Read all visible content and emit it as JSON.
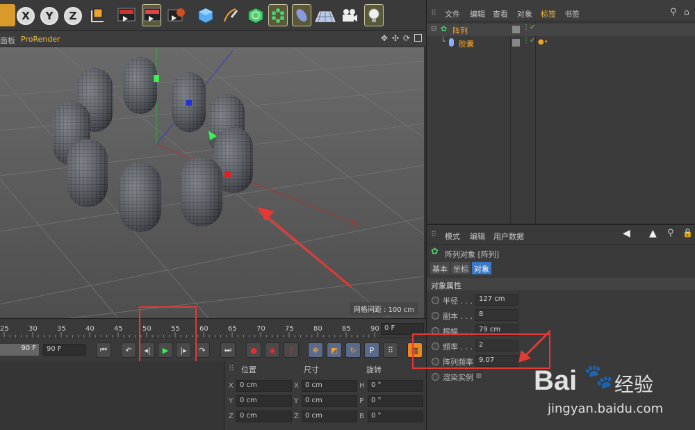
{
  "viewport_menu": {
    "panel_stub": "面板",
    "renderer": "ProRender",
    "grid_spacing": "网格间距 : 100 cm"
  },
  "timeline": {
    "ticks": [
      "25",
      "30",
      "35",
      "40",
      "45",
      "50",
      "55",
      "60",
      "65",
      "70",
      "75",
      "80",
      "85",
      "90"
    ],
    "current_frame": "0 F"
  },
  "transport": {
    "start_frame": "90 F",
    "end_frame": "90 F"
  },
  "coords": {
    "headers": [
      "位置",
      "尺寸",
      "旋转"
    ],
    "rows": [
      {
        "a": "X",
        "pos": "0 cm",
        "b": "X",
        "size": "0 cm",
        "c": "H",
        "rot": "0 °"
      },
      {
        "a": "Y",
        "pos": "0 cm",
        "b": "Y",
        "size": "0 cm",
        "c": "P",
        "rot": "0 °"
      },
      {
        "a": "Z",
        "pos": "0 cm",
        "b": "Z",
        "size": "0 cm",
        "c": "B",
        "rot": "0 °"
      }
    ]
  },
  "object_manager": {
    "menu": [
      "文件",
      "编辑",
      "查看",
      "对象",
      "标签",
      "书签"
    ],
    "objects": [
      {
        "name": "阵列"
      },
      {
        "name": "胶囊"
      }
    ]
  },
  "attributes": {
    "menu": [
      "模式",
      "编辑",
      "用户数据"
    ],
    "title": "阵列对象 [阵列]",
    "tabs": [
      "基本",
      "坐标",
      "对象"
    ],
    "section": "对象属性",
    "params": [
      {
        "label": "半径 . . .",
        "value": "127 cm"
      },
      {
        "label": "副本 . . .",
        "value": "8"
      },
      {
        "label": "振幅 . . .",
        "value": "79 cm"
      },
      {
        "label": "频率 . . .",
        "value": "2"
      },
      {
        "label": "阵列频率",
        "value": "9.07"
      }
    ],
    "render_instances": "渲染实例"
  },
  "watermark": {
    "brand_text": "Bai",
    "brand_text2": "经验",
    "url": "jingyan.baidu.com"
  },
  "colors": {
    "accent_orange": "#f5a623",
    "annotation_red": "#e53935",
    "selected_blue": "#3a78c8"
  }
}
